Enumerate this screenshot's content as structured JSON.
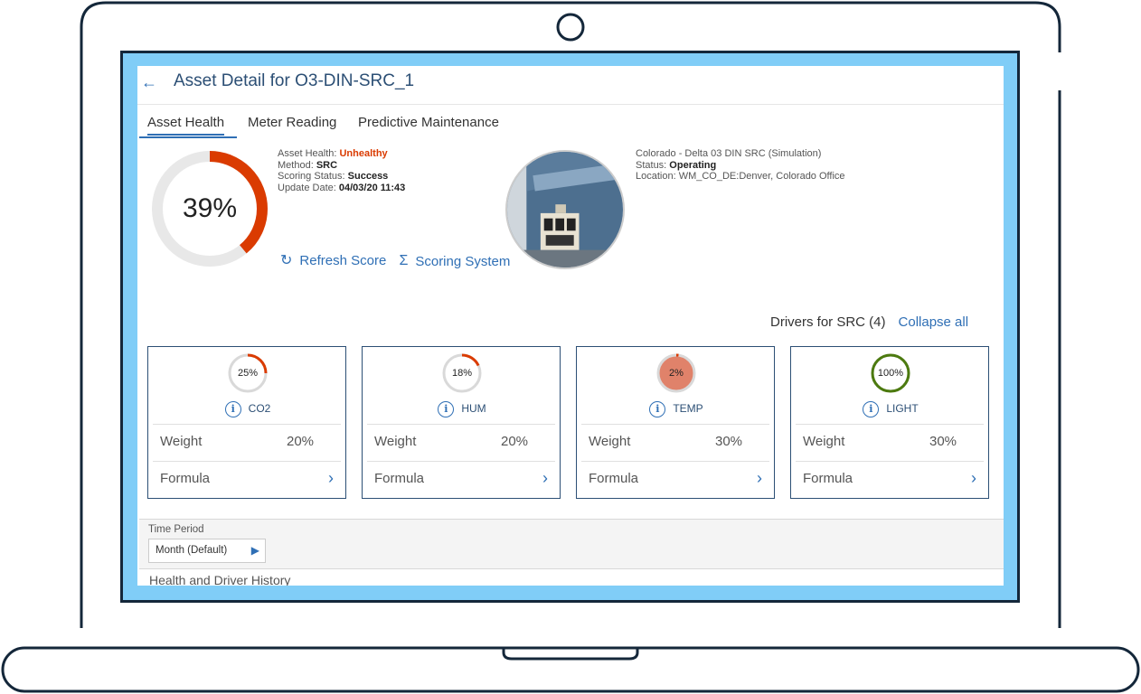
{
  "header": {
    "title": "Asset Detail for O3-DIN-SRC_1",
    "back_icon": "arrow-left-icon"
  },
  "tabs": [
    {
      "label": "Asset Health",
      "active": true
    },
    {
      "label": "Meter Reading",
      "active": false
    },
    {
      "label": "Predictive Maintenance",
      "active": false
    }
  ],
  "health": {
    "score_text": "39%",
    "score": 39,
    "color": "#da3b01",
    "status_label": "Asset Health: ",
    "status_value": "Unhealthy",
    "method_label": "Method: ",
    "method_value": "SRC",
    "scoring_label": "Scoring Status: ",
    "scoring_value": "Success",
    "update_label": "Update Date: ",
    "update_value": "04/03/20 11:43"
  },
  "actions": {
    "refresh": {
      "label": "Refresh Score",
      "icon": "refresh-icon"
    },
    "scoring": {
      "label": "Scoring System",
      "icon": "sigma-icon"
    }
  },
  "asset": {
    "name": "Colorado - Delta 03 DIN SRC (Simulation)",
    "status_label": "Status: ",
    "status_value": "Operating",
    "location_label": "Location: ",
    "location_value": "WM_CO_DE:Denver, Colorado Office"
  },
  "drivers": {
    "title": "Drivers for SRC (4)",
    "collapse_label": "Collapse all",
    "weight_label": "Weight",
    "formula_label": "Formula",
    "items": [
      {
        "name": "CO2",
        "score": 25,
        "score_text": "25%",
        "weight": "20%",
        "color": "#da3b01"
      },
      {
        "name": "HUM",
        "score": 18,
        "score_text": "18%",
        "weight": "20%",
        "color": "#da3b01"
      },
      {
        "name": "TEMP",
        "score": 2,
        "score_text": "2%",
        "weight": "30%",
        "color": "#da3b01",
        "fill": "#e0826a"
      },
      {
        "name": "LIGHT",
        "score": 100,
        "score_text": "100%",
        "weight": "30%",
        "color": "#4c7a0f"
      }
    ]
  },
  "time_period": {
    "label": "Time Period",
    "value": "Month (Default)"
  },
  "history": {
    "title": "Health and Driver History"
  }
}
